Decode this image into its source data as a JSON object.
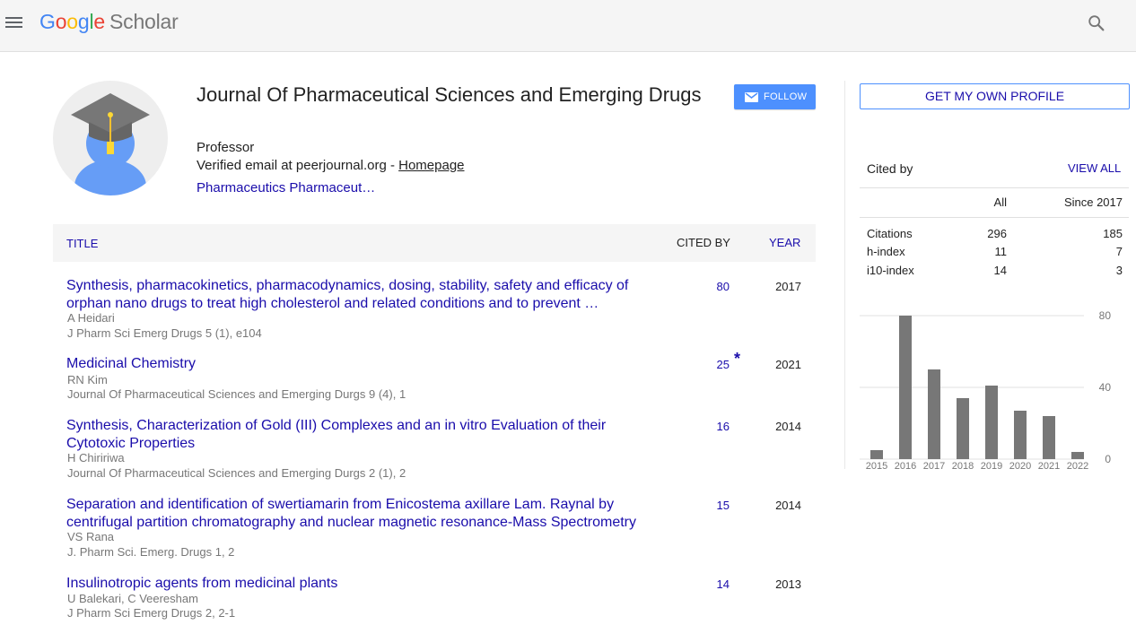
{
  "topbar": {
    "logo": {
      "google": [
        "G",
        "o",
        "o",
        "g",
        "l",
        "e"
      ],
      "product": "Scholar"
    }
  },
  "profile": {
    "name": "Journal Of Pharmaceutical Sciences and Emerging Drugs",
    "affiliation": "Professor",
    "email_text": "Verified email at peerjournal.org - ",
    "homepage_label": "Homepage",
    "interests": "Pharmaceutics Pharmaceut…",
    "follow_label": "FOLLOW"
  },
  "table": {
    "headers": {
      "title": "TITLE",
      "cited_by": "CITED BY",
      "year": "YEAR"
    },
    "rows": [
      {
        "title": "Synthesis, pharmacokinetics, pharmacodynamics, dosing, stability, safety and efficacy of orphan nano drugs to treat high cholesterol and related conditions and to prevent …",
        "authors": "A Heidari",
        "venue": "J Pharm Sci Emerg Drugs 5 (1), e104",
        "cited": "80",
        "star": "",
        "year": "2017"
      },
      {
        "title": "Medicinal Chemistry",
        "authors": "RN Kim",
        "venue": "Journal Of Pharmaceutical Sciences and Emerging Durgs 9 (4), 1",
        "cited": "25",
        "star": "*",
        "year": "2021"
      },
      {
        "title": "Synthesis, Characterization of Gold (III) Complexes and an in vitro Evaluation of their Cytotoxic Properties",
        "authors": "H Chiririwa",
        "venue": "Journal Of Pharmaceutical Sciences and Emerging Durgs 2 (1), 2",
        "cited": "16",
        "star": "",
        "year": "2014"
      },
      {
        "title": "Separation and identification of swertiamarin from Enicostema axillare Lam. Raynal by centrifugal partition chromatography and nuclear magnetic resonance-Mass Spectrometry",
        "authors": "VS Rana",
        "venue": "J. Pharm Sci. Emerg. Drugs 1, 2",
        "cited": "15",
        "star": "",
        "year": "2014"
      },
      {
        "title": "Insulinotropic agents from medicinal plants",
        "authors": "U Balekari, C Veeresham",
        "venue": "J Pharm Sci Emerg Drugs 2, 2-1",
        "cited": "14",
        "star": "",
        "year": "2013"
      }
    ]
  },
  "sidebar": {
    "get_profile_label": "GET MY OWN PROFILE",
    "cited_by_label": "Cited by",
    "view_all_label": "VIEW ALL",
    "col_all": "All",
    "col_since": "Since 2017",
    "stats": [
      {
        "label": "Citations",
        "all": "296",
        "since": "185"
      },
      {
        "label": "h-index",
        "all": "11",
        "since": "7"
      },
      {
        "label": "i10-index",
        "all": "14",
        "since": "3"
      }
    ]
  },
  "chart_data": {
    "type": "bar",
    "categories": [
      "2015",
      "2016",
      "2017",
      "2018",
      "2019",
      "2020",
      "2021",
      "2022"
    ],
    "values": [
      5,
      80,
      50,
      34,
      41,
      27,
      24,
      4
    ],
    "ylim": [
      0,
      80
    ],
    "yticks": [
      "80",
      "40",
      "0"
    ],
    "grid": true,
    "bar_color": "#777777"
  },
  "colors": {
    "link": "#1a0dab",
    "accent": "#4d90fe",
    "topbar_bg": "#f5f5f5"
  }
}
